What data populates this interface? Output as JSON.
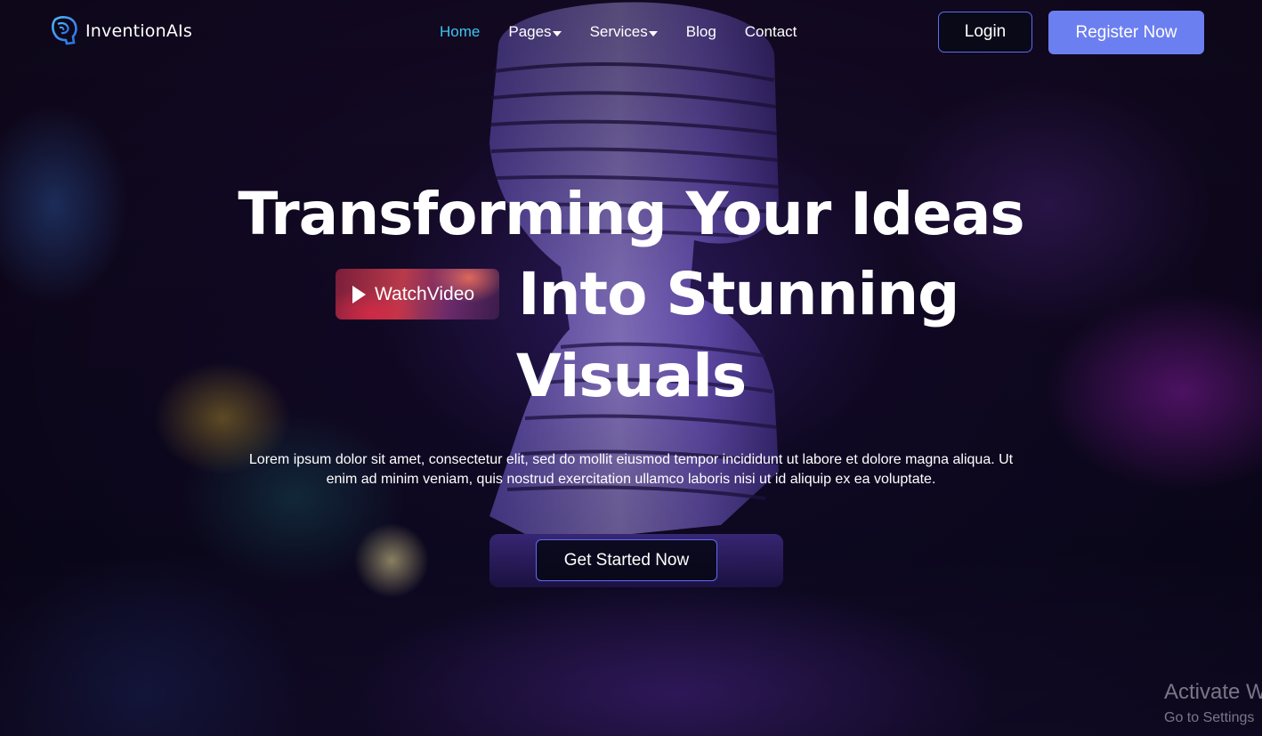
{
  "brand": {
    "name": "InventionAIs",
    "logo_icon": "brain-head-icon",
    "accent": "#3cc6f0"
  },
  "nav": {
    "items": [
      {
        "label": "Home",
        "active": true
      },
      {
        "label": "Pages",
        "dropdown": true
      },
      {
        "label": "Services",
        "dropdown": true
      },
      {
        "label": "Blog"
      },
      {
        "label": "Contact"
      }
    ]
  },
  "auth": {
    "login_label": "Login",
    "register_label": "Register Now",
    "register_color": "#6c7ff0",
    "outline_color": "#5c6cf4"
  },
  "hero": {
    "title_line1": "Transforming Your Ideas",
    "title_line2": "Into Stunning",
    "title_line3": "Visuals",
    "watch_video_label": "WatchVideo",
    "description": "Lorem ipsum dolor sit amet, consectetur elit, sed do mollit eiusmod tempor incididunt ut labore et dolore magna aliqua. Ut enim ad minim veniam, quis nostrud exercitation ullamco laboris nisi ut id aliquip ex ea voluptate.",
    "cta_label": "Get Started Now"
  },
  "watermark": {
    "line1": "Activate W",
    "line2": "Go to Settings"
  }
}
